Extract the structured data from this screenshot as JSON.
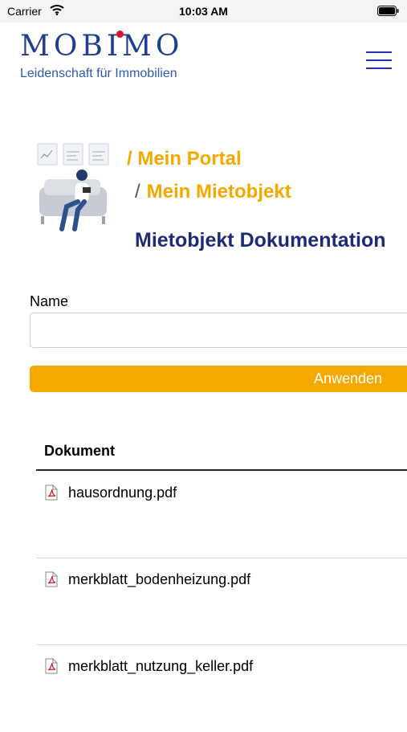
{
  "status_bar": {
    "carrier": "Carrier",
    "time": "10:03 AM"
  },
  "header": {
    "brand": "MOBIMO",
    "tagline": "Leidenschaft für Immobilien"
  },
  "breadcrumb": {
    "item1": "/ Mein Portal",
    "separator": "/",
    "item2": "Mein Mietobjekt"
  },
  "page_title": "Mietobjekt Dokumentation",
  "filter": {
    "name_label": "Name",
    "name_value": "",
    "apply_label": "Anwenden"
  },
  "table": {
    "header": "Dokument",
    "rows": [
      {
        "file": "hausordnung.pdf"
      },
      {
        "file": "merkblatt_bodenheizung.pdf"
      },
      {
        "file": "merkblatt_nutzung_keller.pdf"
      }
    ]
  },
  "colors": {
    "accent": "#f5a900",
    "brand": "#1e3f8f",
    "title": "#1c2a78",
    "logo_dot": "#d21429",
    "menu": "#2630b5"
  }
}
